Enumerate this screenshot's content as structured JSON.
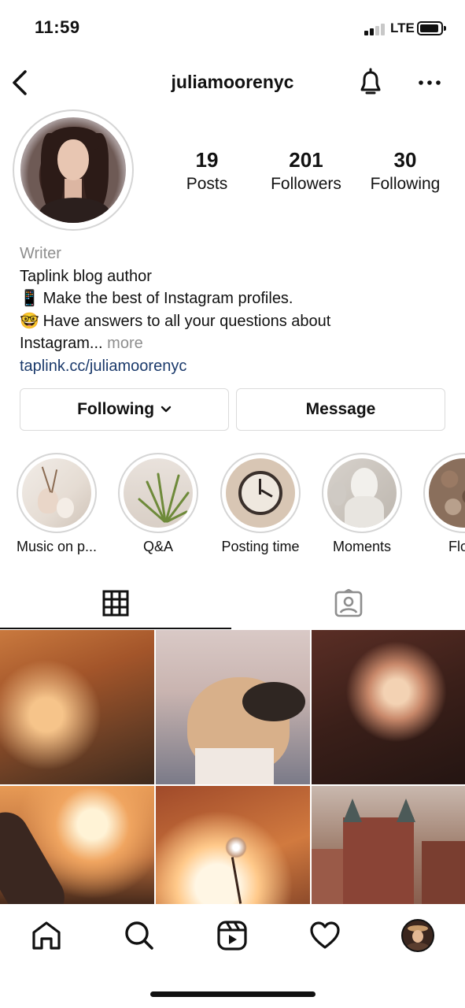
{
  "status_bar": {
    "time": "11:59",
    "network": "LTE"
  },
  "header": {
    "username": "juliamoorenyc"
  },
  "stats": [
    {
      "value": "19",
      "label": "Posts"
    },
    {
      "value": "201",
      "label": "Followers"
    },
    {
      "value": "30",
      "label": "Following"
    }
  ],
  "bio": {
    "category": "Writer",
    "line1": "Taplink blog author",
    "line2_emoji": "📱",
    "line2": "Make the best of Instagram profiles.",
    "line3_emoji": "🤓",
    "line3": "Have answers to all your questions about",
    "line4": "Instagram...",
    "more": "more",
    "link": "taplink.cc/juliamoorenyc"
  },
  "actions": {
    "following_label": "Following",
    "message_label": "Message"
  },
  "highlights": [
    {
      "label": "Music on p..."
    },
    {
      "label": "Q&A"
    },
    {
      "label": "Posting time"
    },
    {
      "label": "Moments"
    },
    {
      "label": "Flow"
    }
  ],
  "tabs": [
    {
      "icon": "grid-icon",
      "active": true
    },
    {
      "icon": "tagged-icon",
      "active": false
    }
  ],
  "nav": [
    "home-icon",
    "search-icon",
    "reels-icon",
    "heart-icon",
    "profile-avatar"
  ],
  "colors": {
    "link": "#1b3a6b",
    "muted": "#8e8e8e",
    "border": "#dbdbdb"
  }
}
